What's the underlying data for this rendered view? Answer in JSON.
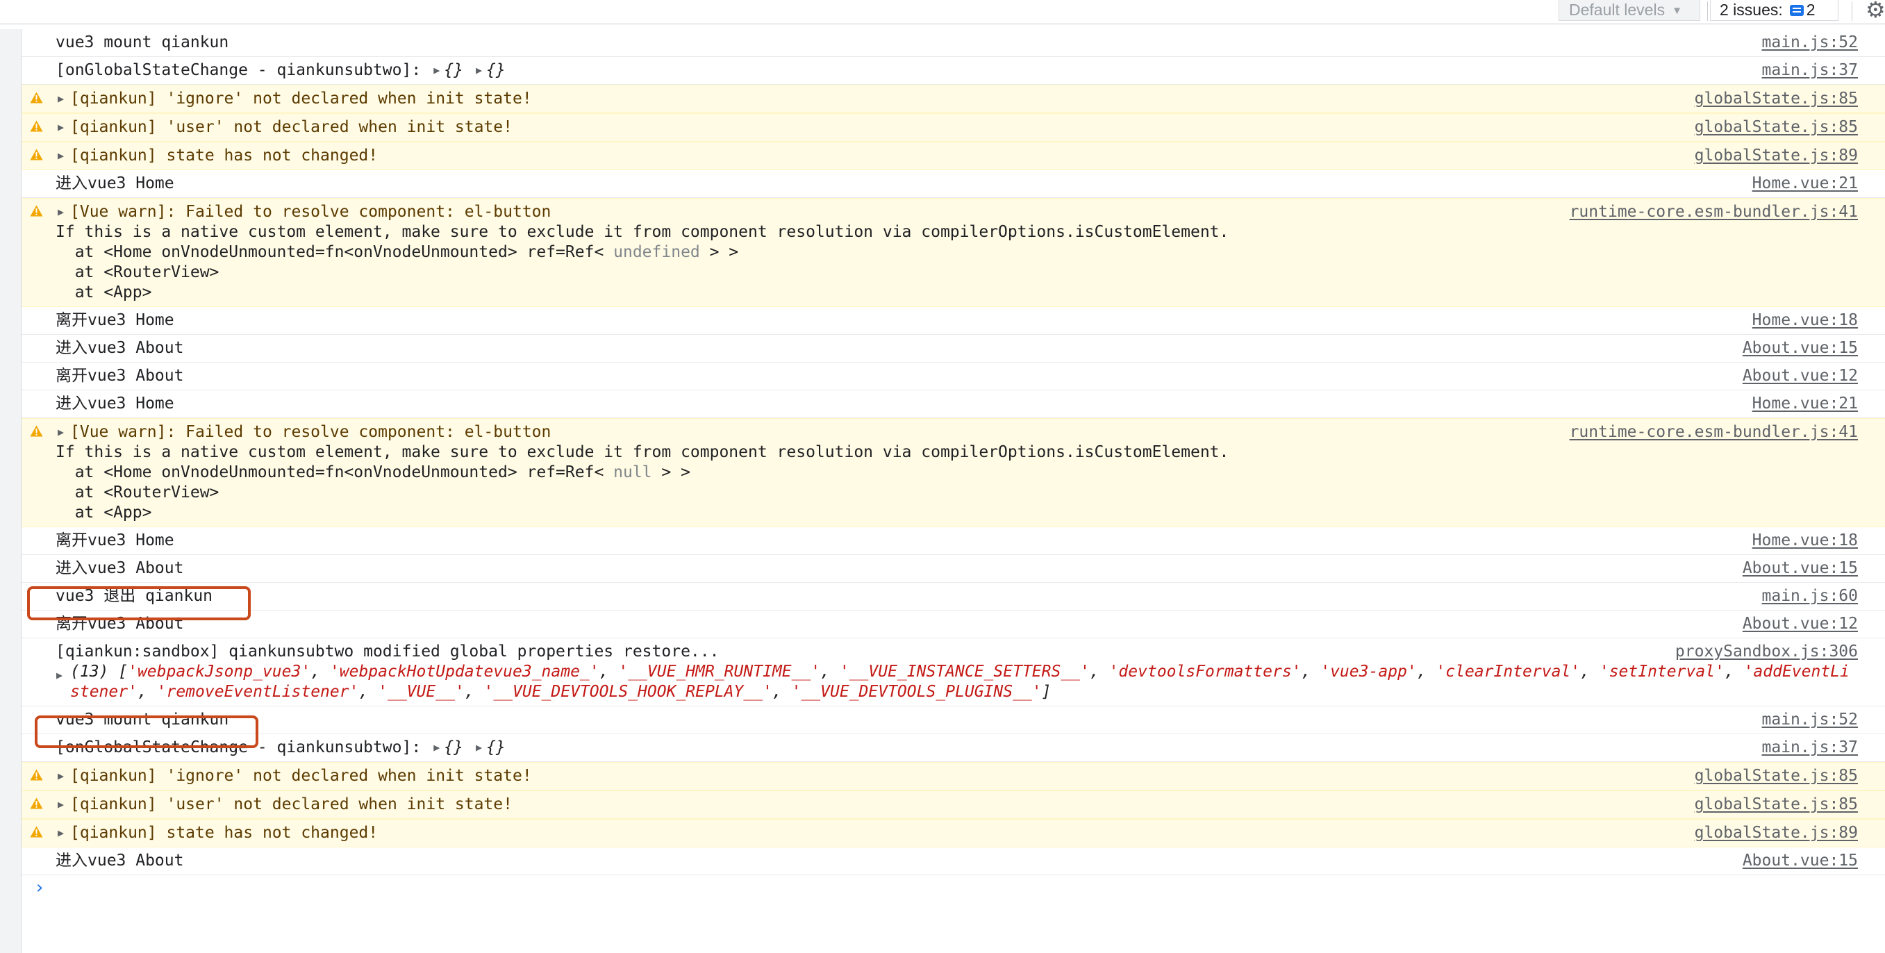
{
  "toolbar": {
    "levels_label": "Default levels",
    "levels_caret": "▼",
    "issues_label": "2 issues:",
    "issues_count": "2",
    "settings_glyph": "⚙"
  },
  "colors": {
    "warning_bg": "#fffbe5",
    "warning_icon": "#f2a600",
    "highlight_box": "#c9491c",
    "string_literal": "#c41a16",
    "prompt_accent": "#1a73e8"
  },
  "messages": [
    {
      "text": "vue3 mount qiankun",
      "source": "main.js:52"
    },
    {
      "text": "[onGlobalStateChange - qiankunsubtwo]:",
      "obj1": "{}",
      "obj2": "{}",
      "source": "main.js:37"
    },
    {
      "text": "[qiankun] 'ignore' not declared when init state!",
      "source": "globalState.js:85"
    },
    {
      "text": "[qiankun] 'user' not declared when init state!",
      "source": "globalState.js:85"
    },
    {
      "text": "[qiankun] state has not changed!",
      "source": "globalState.js:89"
    },
    {
      "text": "进入vue3 Home",
      "source": "Home.vue:21"
    },
    {
      "text": "[Vue warn]: Failed to resolve component: el-button",
      "line2": "If this is a native custom element, make sure to exclude it from component resolution via compilerOptions.isCustomElement.",
      "line3_pre": "  at <Home onVnodeUnmounted=fn<onVnodeUnmounted> ref=Ref< ",
      "line3_val": "undefined",
      "line3_post": " > >",
      "line4": "  at <RouterView>",
      "line5": "  at <App>",
      "source": "runtime-core.esm-bundler.js:41"
    },
    {
      "text": "离开vue3 Home",
      "source": "Home.vue:18"
    },
    {
      "text": "进入vue3 About",
      "source": "About.vue:15"
    },
    {
      "text": "离开vue3 About",
      "source": "About.vue:12"
    },
    {
      "text": "进入vue3 Home",
      "source": "Home.vue:21"
    },
    {
      "text": "[Vue warn]: Failed to resolve component: el-button",
      "line2": "If this is a native custom element, make sure to exclude it from component resolution via compilerOptions.isCustomElement.",
      "line3_pre": "  at <Home onVnodeUnmounted=fn<onVnodeUnmounted> ref=Ref< ",
      "line3_val": "null",
      "line3_post": " > >",
      "line4": "  at <RouterView>",
      "line5": "  at <App>",
      "source": "runtime-core.esm-bundler.js:41"
    },
    {
      "text": "离开vue3 Home",
      "source": "Home.vue:18"
    },
    {
      "text": "进入vue3 About",
      "source": "About.vue:15"
    },
    {
      "text": "vue3 退出 qiankun",
      "source": "main.js:60"
    },
    {
      "text": "离开vue3 About",
      "source": "About.vue:12"
    },
    {
      "text": "[qiankun:sandbox] qiankunsubtwo modified global properties restore...",
      "array_count": "(13) [",
      "array_items": [
        "'webpackJsonp_vue3'",
        "'webpackHotUpdatevue3_name_'",
        "'__VUE_HMR_RUNTIME__'",
        "'__VUE_INSTANCE_SETTERS__'",
        "'devtoolsFormatters'",
        "'vue3-app'",
        "'clearInterval'",
        "'setInterval'",
        "'addEventListener'",
        "'removeEventListener'",
        "'__VUE__'",
        "'__VUE_DEVTOOLS_HOOK_REPLAY__'",
        "'__VUE_DEVTOOLS_PLUGINS__'"
      ],
      "array_close": "]",
      "source": "proxySandbox.js:306"
    },
    {
      "text": "vue3 mount qiankun",
      "source": "main.js:52"
    },
    {
      "text": "[onGlobalStateChange - qiankunsubtwo]:",
      "obj1": "{}",
      "obj2": "{}",
      "source": "main.js:37"
    },
    {
      "text": "[qiankun] 'ignore' not declared when init state!",
      "source": "globalState.js:85"
    },
    {
      "text": "[qiankun] 'user' not declared when init state!",
      "source": "globalState.js:85"
    },
    {
      "text": "[qiankun] state has not changed!",
      "source": "globalState.js:89"
    },
    {
      "text": "进入vue3 About",
      "source": "About.vue:15"
    }
  ],
  "prompt_glyph": "›"
}
